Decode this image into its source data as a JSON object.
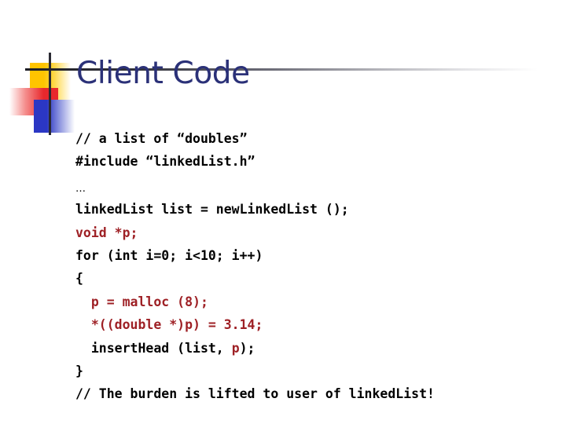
{
  "slide": {
    "title": "Client Code",
    "title_color": "#2B3178",
    "accent_red": "#9E2025",
    "accent_black": "#000000",
    "background": "#ffffff"
  },
  "decoration": {
    "yellow_square": "#FFC400",
    "red_square": "#E8282C",
    "blue_square": "#2B37C4",
    "rule_color": "#1d1d24"
  },
  "code": {
    "lines": [
      {
        "id": "line-comment-doubles",
        "segments": [
          {
            "text": "// a list of “doubles”",
            "color": "black"
          }
        ]
      },
      {
        "id": "line-include",
        "segments": [
          {
            "text": "#include “linkedList.h”",
            "color": "black"
          }
        ]
      },
      {
        "id": "line-ellipsis",
        "ellipsis": "…",
        "segments": []
      },
      {
        "id": "line-declare-list",
        "segments": [
          {
            "text": "linkedList list = newLinkedList ();",
            "color": "black"
          }
        ]
      },
      {
        "id": "line-void-p",
        "segments": [
          {
            "text": "void *p;",
            "color": "red"
          }
        ]
      },
      {
        "id": "line-for-loop",
        "segments": [
          {
            "text": "for (int i=0; i<10; i++)",
            "color": "black"
          }
        ]
      },
      {
        "id": "line-open-brace",
        "segments": [
          {
            "text": "{",
            "color": "black"
          }
        ]
      },
      {
        "id": "line-malloc",
        "segments": [
          {
            "text": "  p = malloc (8);",
            "color": "red"
          }
        ]
      },
      {
        "id": "line-cast-assign",
        "segments": [
          {
            "text": "  *((double *)p) = 3.14;",
            "color": "red"
          }
        ]
      },
      {
        "id": "line-insert-head",
        "segments": [
          {
            "text": "  insertHead (list, ",
            "color": "black"
          },
          {
            "text": "p",
            "color": "red"
          },
          {
            "text": ");",
            "color": "black"
          }
        ]
      },
      {
        "id": "line-close-brace",
        "segments": [
          {
            "text": "}",
            "color": "black"
          }
        ]
      },
      {
        "id": "line-comment-burden",
        "segments": [
          {
            "text": "// The burden is lifted to user of linkedList!",
            "color": "black"
          }
        ]
      }
    ]
  }
}
